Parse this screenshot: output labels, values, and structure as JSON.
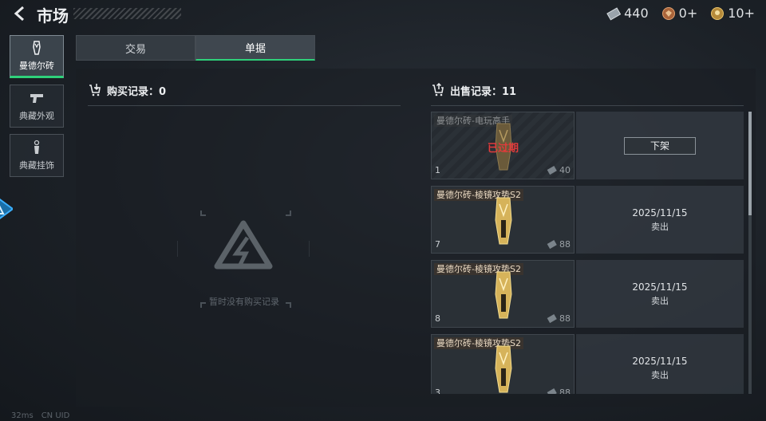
{
  "header": {
    "title": "市场",
    "currencies": [
      {
        "icon": "banknote-icon",
        "value": "440"
      },
      {
        "icon": "coin-icon",
        "value": "0+"
      },
      {
        "icon": "token-icon",
        "value": "10+"
      }
    ]
  },
  "sidebar": {
    "items": [
      {
        "label": "曼德尔砖",
        "icon": "brick-icon"
      },
      {
        "label": "典藏外观",
        "icon": "pistol-icon"
      },
      {
        "label": "典藏挂饰",
        "icon": "charm-icon"
      }
    ]
  },
  "tabs": [
    {
      "label": "交易"
    },
    {
      "label": "单据"
    }
  ],
  "buy_records": {
    "heading": "购买记录：0",
    "empty_text": "暂时没有购买记录"
  },
  "sell_records": {
    "heading": "出售记录：11",
    "rows": [
      {
        "name": "曼德尔砖-电玩高手",
        "qty": "1",
        "price": "40",
        "expired_label": "已过期",
        "action_label": "下架"
      },
      {
        "name": "曼德尔砖-棱镜攻势S2",
        "qty": "7",
        "price": "88",
        "date": "2025/11/15",
        "status": "卖出"
      },
      {
        "name": "曼德尔砖-棱镜攻势S2",
        "qty": "8",
        "price": "88",
        "date": "2025/11/15",
        "status": "卖出"
      },
      {
        "name": "曼德尔砖-棱镜攻势S2",
        "qty": "3",
        "price": "88",
        "date": "2025/11/15",
        "status": "卖出"
      }
    ]
  },
  "footer": {
    "ping": "32ms",
    "uid": "CN UID"
  }
}
